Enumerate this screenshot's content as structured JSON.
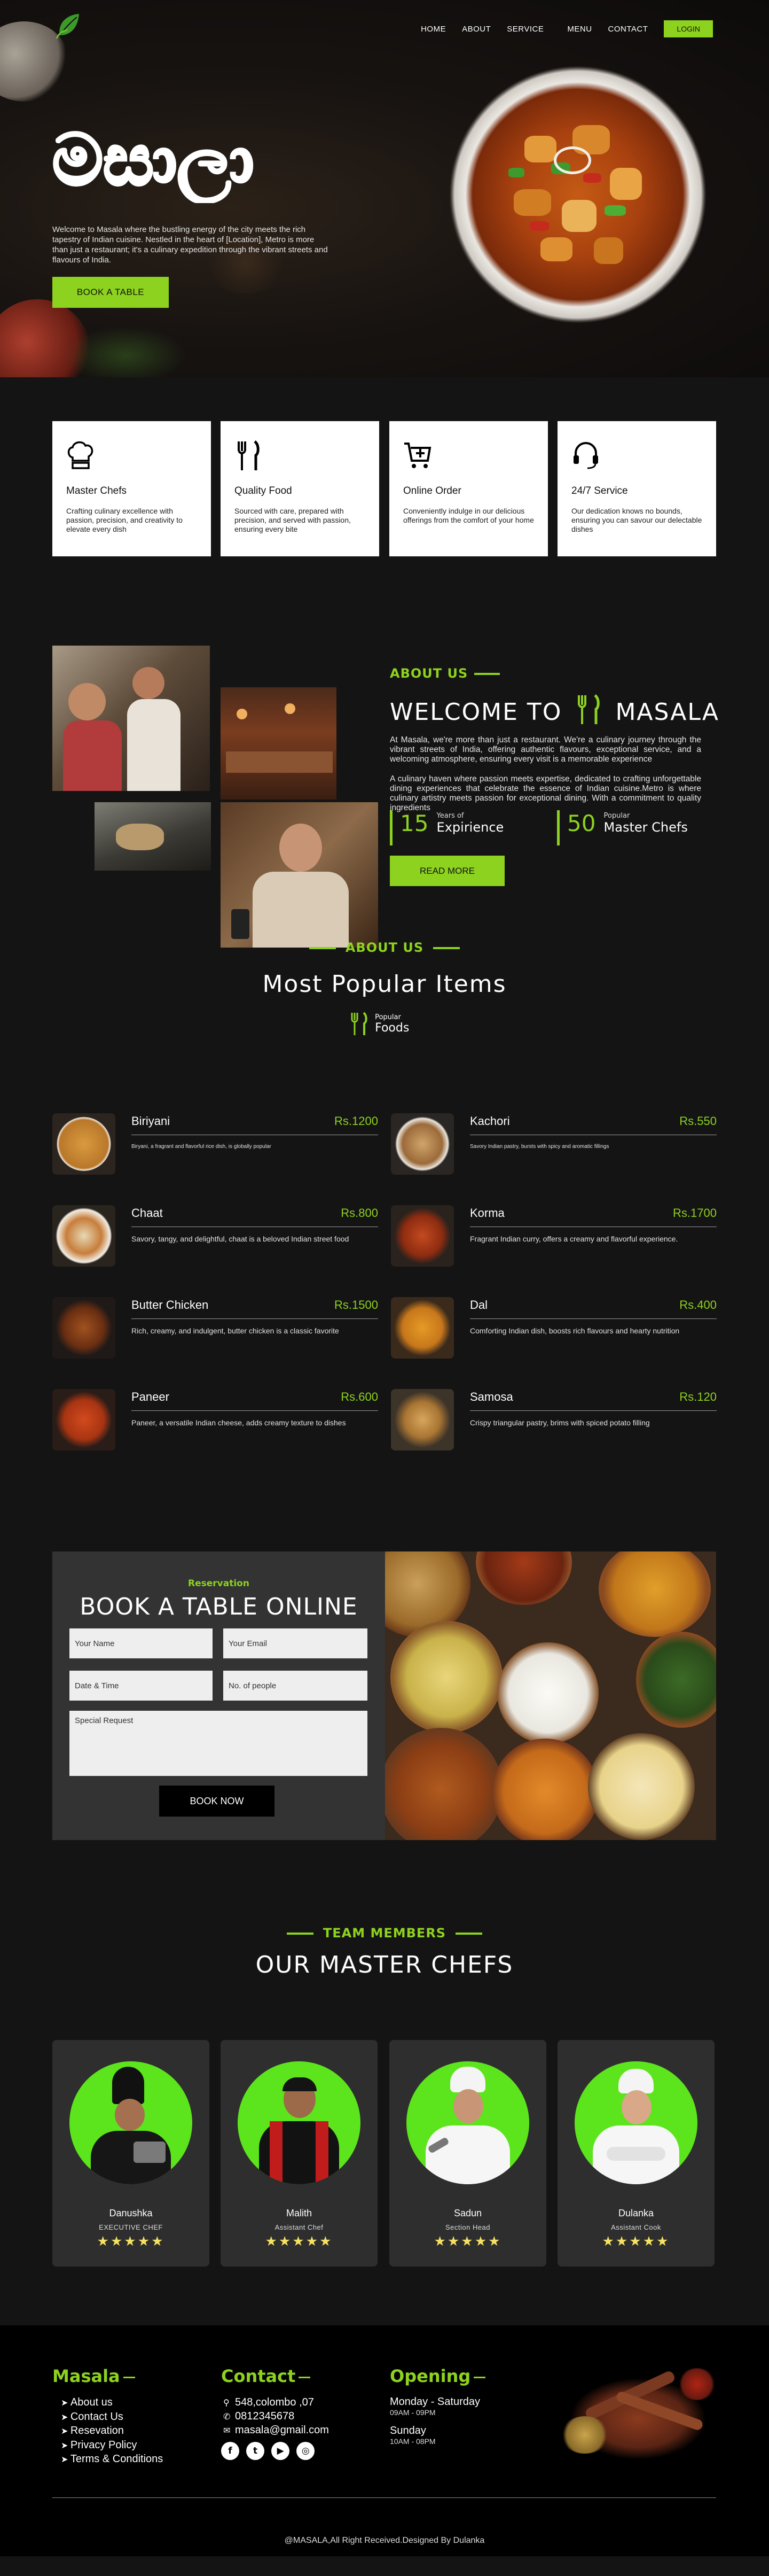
{
  "nav": {
    "links": [
      "HOME",
      "ABOUT",
      "SERVICE",
      "MENU",
      "CONTACT"
    ],
    "login": "LOGIN"
  },
  "hero": {
    "script_title": "මසාලා",
    "text": "Welcome to Masala where the bustling energy of the city meets the rich tapestry of Indian cuisine. Nestled in the heart of [Location], Metro is more than just a restaurant; it's a culinary expedition through the vibrant streets and flavours of India.",
    "cta": "BOOK A TABLE"
  },
  "features": [
    {
      "icon": "chef-hat-icon",
      "title": "Master Chefs",
      "text": "Crafting culinary excellence with passion, precision, and creativity to elevate every dish"
    },
    {
      "icon": "fork-knife-icon",
      "title": "Quality Food",
      "text": "Sourced with care, prepared with precision, and served with passion, ensuring every bite"
    },
    {
      "icon": "cart-icon",
      "title": "Online Order",
      "text": "Conveniently indulge in our delicious offerings from the comfort of your home"
    },
    {
      "icon": "headset-icon",
      "title": "24/7 Service",
      "text": "Our dedication knows no bounds, ensuring you can savour our delectable dishes"
    }
  ],
  "about": {
    "label": "ABOUT US",
    "title_left": "WELCOME TO",
    "title_right": "MASALA",
    "p1": "At Masala, we're more than just a restaurant. We're a culinary journey through the vibrant streets of India, offering authentic flavours, exceptional service, and a welcoming atmosphere, ensuring every visit is a memorable experience",
    "p2": "A culinary haven where passion meets expertise, dedicated to crafting unforgettable dining experiences that celebrate the essence of Indian cuisine.Metro is where culinary artistry meets passion for exceptional dining. With a commitment to quality ingredients",
    "stats": [
      {
        "num": "15",
        "small": "Years of",
        "big": "Expirience"
      },
      {
        "num": "50",
        "small": "Popular",
        "big": "Master Chefs"
      }
    ],
    "cta": "READ MORE"
  },
  "menu": {
    "label": "ABOUT US",
    "title": "Most Popular Items",
    "sub_small": "Popular",
    "sub_big": "Foods",
    "items": [
      {
        "name": "Biriyani",
        "price": "Rs.1200",
        "desc": "Biryani, a fragrant and flavorful rice dish, is globally popular"
      },
      {
        "name": "Kachori",
        "price": "Rs.550",
        "desc": "Savory Indian pastry, bursts with spicy and aromatic fillings"
      },
      {
        "name": "Chaat",
        "price": "Rs.800",
        "desc": "Savory, tangy, and delightful, chaat is a beloved Indian street food"
      },
      {
        "name": "Korma",
        "price": "Rs.1700",
        "desc": "Fragrant Indian curry, offers a creamy and flavorful experience."
      },
      {
        "name": "Butter Chicken",
        "price": "Rs.1500",
        "desc": "Rich, creamy, and indulgent, butter chicken is a classic favorite"
      },
      {
        "name": "Dal",
        "price": "Rs.400",
        "desc": "Comforting Indian dish, boosts rich flavours and hearty nutrition"
      },
      {
        "name": "Paneer",
        "price": "Rs.600",
        "desc": "Paneer, a versatile Indian cheese, adds creamy texture to dishes"
      },
      {
        "name": "Samosa",
        "price": "Rs.120",
        "desc": "Crispy triangular pastry, brims with spiced potato filling"
      }
    ]
  },
  "reservation": {
    "label": "Reservation",
    "title": "BOOK A TABLE ONLINE",
    "placeholders": {
      "name": "Your Name",
      "email": "Your Email",
      "datetime": "Date & Time",
      "people": "No. of people",
      "request": "Special Request"
    },
    "cta": "BOOK NOW"
  },
  "team": {
    "label": "TEAM MEMBERS",
    "title": "OUR MASTER CHEFS",
    "chefs": [
      {
        "name": "Danushka",
        "role": "EXECUTIVE CHEF",
        "stars": "★★★★★"
      },
      {
        "name": "Malith",
        "role": "Assistant Chef",
        "stars": "★★★★★"
      },
      {
        "name": "Sadun",
        "role": "Section Head",
        "stars": "★★★★★"
      },
      {
        "name": "Dulanka",
        "role": "Assistant Cook",
        "stars": "★★★★★"
      }
    ]
  },
  "footer": {
    "col1_title": "Masala",
    "links": [
      "About us",
      "Contact Us",
      "Resevation",
      "Privacy Policy",
      "Terms & Conditions"
    ],
    "col2_title": "Contact",
    "address": "548,colombo ,07",
    "phone": "0812345678",
    "email": "masala@gmail.com",
    "col3_title": "Opening",
    "h1": "Monday - Saturday",
    "s1": "09AM - 09PM",
    "h2": "Sunday",
    "s2": "10AM - 08PM",
    "copyright": "@MASALA,All Right Received.Designed By Dulanka"
  },
  "colors": {
    "accent": "#8dd21f",
    "chef_circle": "#5ce41c",
    "star": "#f5e163"
  }
}
